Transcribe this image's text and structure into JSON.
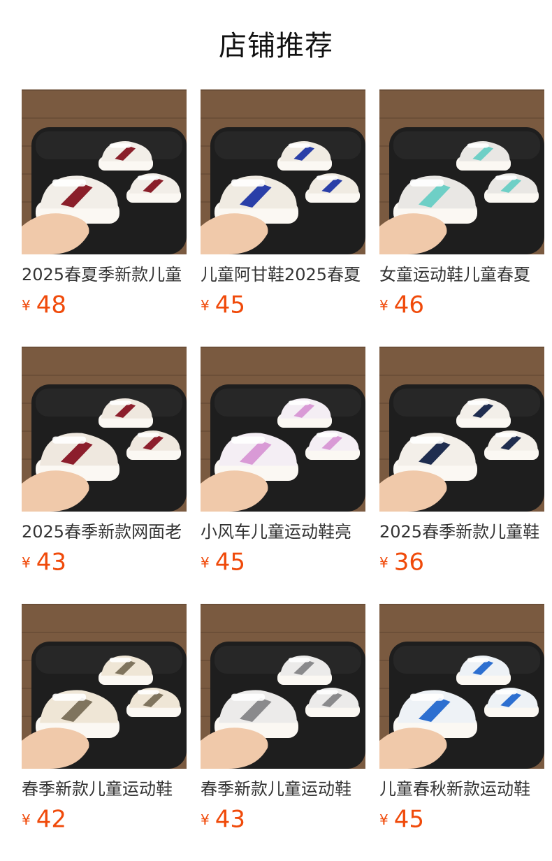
{
  "header": {
    "title": "店铺推荐"
  },
  "currency_symbol": "¥",
  "colors": {
    "price": "#f04a0a",
    "title_text": "#333333",
    "floor_wood": "#7a5a40",
    "stool_black": "#1e1e1e"
  },
  "products": [
    {
      "title": "2025春夏季新款儿童",
      "price": "48",
      "image": "shoe-photo-burgundy-laces",
      "shoe_color": "#f2eee8",
      "accent_color": "#8a1f2a"
    },
    {
      "title": "儿童阿甘鞋2025春夏",
      "price": "45",
      "image": "shoe-photo-blue-stripe",
      "shoe_color": "#f0ebe2",
      "accent_color": "#2a3fa8"
    },
    {
      "title": "女童运动鞋儿童春夏",
      "price": "46",
      "image": "shoe-photo-grey-mint",
      "shoe_color": "#e9e7e4",
      "accent_color": "#6ecfc6"
    },
    {
      "title": "2025春季新款网面老",
      "price": "43",
      "image": "shoe-photo-burgundy-mesh",
      "shoe_color": "#efe8df",
      "accent_color": "#8c1e2c"
    },
    {
      "title": "小风车儿童运动鞋亮",
      "price": "45",
      "image": "shoe-photo-pink-led",
      "shoe_color": "#f4eef4",
      "accent_color": "#d99ad6"
    },
    {
      "title": "2025春季新款儿童鞋",
      "price": "36",
      "image": "shoe-photo-navy-cross",
      "shoe_color": "#f3efe9",
      "accent_color": "#1f2d4f"
    },
    {
      "title": "春季新款儿童运动鞋",
      "price": "42",
      "image": "shoe-photo-khaki-chunky",
      "shoe_color": "#efe6d6",
      "accent_color": "#7f745e"
    },
    {
      "title": "春季新款儿童运动鞋",
      "price": "43",
      "image": "shoe-photo-silver-grey",
      "shoe_color": "#ecebea",
      "accent_color": "#8a8a8c"
    },
    {
      "title": "儿童春秋新款运动鞋",
      "price": "45",
      "image": "shoe-photo-blue-cartoon-led",
      "shoe_color": "#eef2f6",
      "accent_color": "#2d6fd0"
    }
  ]
}
